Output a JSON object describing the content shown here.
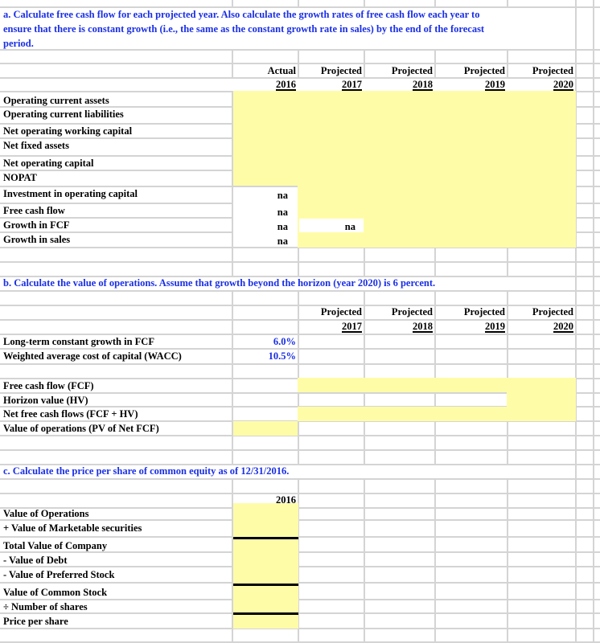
{
  "part_a": {
    "instruction_lines": [
      "a.  Calculate free cash flow for each projected year.  Also calculate the growth rates of free cash flow each year to",
      "ensure that there is constant growth (i.e., the same as the constant growth rate in sales) by the end of the forecast",
      "period."
    ],
    "columns": [
      {
        "top": "Actual",
        "year": "2016"
      },
      {
        "top": "Projected",
        "year": "2017"
      },
      {
        "top": "Projected",
        "year": "2018"
      },
      {
        "top": "Projected",
        "year": "2019"
      },
      {
        "top": "Projected",
        "year": "2020"
      }
    ],
    "rows": [
      {
        "label": "Operating current assets",
        "values": [
          "",
          "",
          "",
          "",
          ""
        ]
      },
      {
        "label": "Operating current liabilities",
        "values": [
          "",
          "",
          "",
          "",
          ""
        ]
      },
      {
        "label": "Net operating working capital",
        "values": [
          "",
          "",
          "",
          "",
          ""
        ]
      },
      {
        "label": "Net fixed assets",
        "values": [
          "",
          "",
          "",
          "",
          ""
        ]
      },
      {
        "label": "Net operating capital",
        "values": [
          "",
          "",
          "",
          "",
          ""
        ]
      },
      {
        "label": "NOPAT",
        "values": [
          "",
          "",
          "",
          "",
          ""
        ]
      },
      {
        "label": "Investment in operating capital",
        "values": [
          "na",
          "",
          "",
          "",
          ""
        ]
      },
      {
        "label": "Free cash flow",
        "values": [
          "na",
          "",
          "",
          "",
          ""
        ]
      },
      {
        "label": "Growth in FCF",
        "values": [
          "na",
          "na",
          "",
          "",
          ""
        ]
      },
      {
        "label": "Growth in sales",
        "values": [
          "na",
          "",
          "",
          "",
          ""
        ]
      }
    ]
  },
  "part_b": {
    "instruction": "b.  Calculate the value of operations.  Assume that growth beyond  the horizon (year 2020) is 6 percent.",
    "columns": [
      {
        "top": "Projected",
        "year": "2017"
      },
      {
        "top": "Projected",
        "year": "2018"
      },
      {
        "top": "Projected",
        "year": "2019"
      },
      {
        "top": "Projected",
        "year": "2020"
      }
    ],
    "inputs": [
      {
        "label": "Long-term constant growth in FCF",
        "value": "6.0%"
      },
      {
        "label": "Weighted average cost of capital (WACC)",
        "value": "10.5%"
      }
    ],
    "rows": [
      {
        "label": "Free cash flow (FCF)"
      },
      {
        "label": "Horizon value (HV)"
      },
      {
        "label": "Net free cash flows (FCF + HV)"
      },
      {
        "label": "Value of operations (PV of Net FCF)"
      }
    ]
  },
  "part_c": {
    "instruction": "c.  Calculate the price per share of common equity as of 12/31/2016.",
    "year": "2016",
    "rows": [
      {
        "label": "Value of Operations"
      },
      {
        "label": "+ Value of Marketable securities"
      },
      {
        "label": "Total Value of Company"
      },
      {
        "label": "- Value of Debt"
      },
      {
        "label": "- Value of Preferred Stock"
      },
      {
        "label": "Value of Common Stock"
      },
      {
        "label": "÷ Number of shares"
      },
      {
        "label": "Price per share"
      }
    ]
  },
  "colors": {
    "input_fill": "#fffca8",
    "instruction_blue": "#1a2fe6",
    "gridline": "#d4d4d4"
  }
}
